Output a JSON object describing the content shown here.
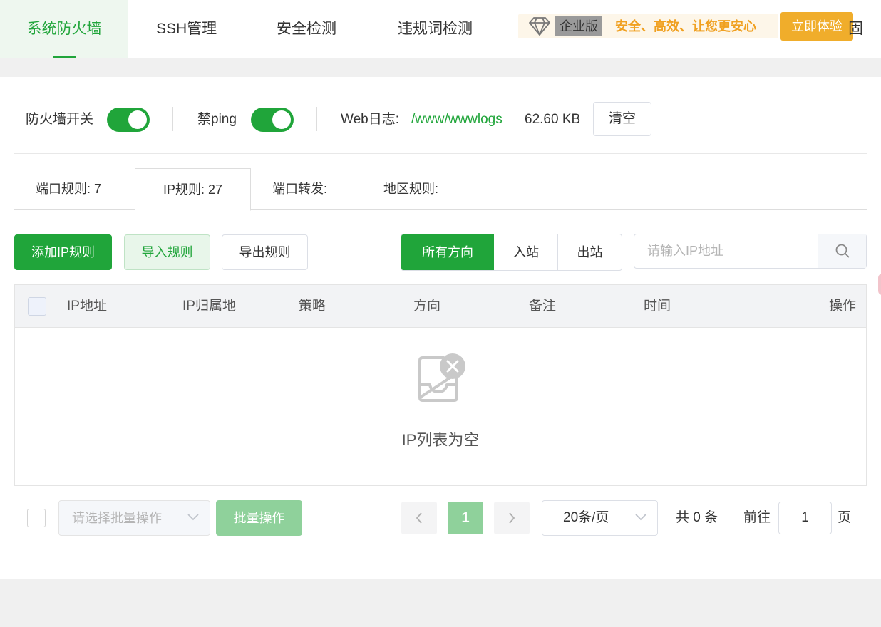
{
  "topbar": {
    "tabs": [
      {
        "label": "系统防火墙",
        "active": true
      },
      {
        "label": "SSH管理",
        "active": false
      },
      {
        "label": "安全检测",
        "active": false
      },
      {
        "label": "违规词检测",
        "active": false
      }
    ],
    "banner": {
      "badge": "企业版",
      "slogan": "安全、高效、让您更安心"
    },
    "try_button": "立即体验",
    "extra_tab": "固"
  },
  "firewall": {
    "switch_label": "防火墙开关",
    "switch_on": true,
    "ping_label": "禁ping",
    "ping_on": true,
    "web_log_label": "Web日志:",
    "web_log_path": "/www/wwwlogs",
    "web_log_size": "62.60 KB",
    "clear_button": "清空"
  },
  "subtabs": [
    {
      "label": "端口规则:  7",
      "active": false
    },
    {
      "label": "IP规则:  27",
      "active": true
    },
    {
      "label": "端口转发:",
      "active": false
    },
    {
      "label": "地区规则:",
      "active": false
    }
  ],
  "toolbar": {
    "add_button": "添加IP规则",
    "import_button": "导入规则",
    "export_button": "导出规则",
    "direction_filters": [
      {
        "label": "所有方向",
        "active": true
      },
      {
        "label": "入站",
        "active": false
      },
      {
        "label": "出站",
        "active": false
      }
    ],
    "search_placeholder": "请输入IP地址"
  },
  "table": {
    "columns": [
      "IP地址",
      "IP归属地",
      "策略",
      "方向",
      "备注",
      "时间",
      "操作"
    ],
    "empty_text": "IP列表为空"
  },
  "footer": {
    "batch_select_placeholder": "请选择批量操作",
    "batch_button": "批量操作",
    "current_page": "1",
    "page_size": "20条/页",
    "total": "共 0 条",
    "goto_label": "前往",
    "goto_value": "1",
    "page_suffix": "页"
  },
  "colors": {
    "accent": "#20a53a",
    "warning": "#f0ad2b"
  }
}
